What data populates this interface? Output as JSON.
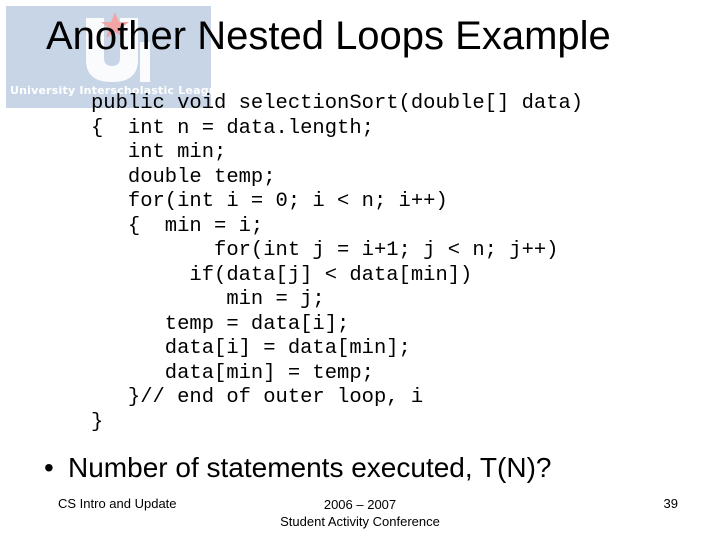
{
  "logo": {
    "text": "University Interscholastic League",
    "colors": {
      "background": "#c7d5e6",
      "letters": "#ffffff",
      "star": "#f2a5a5"
    }
  },
  "title": "Another Nested Loops Example",
  "code_lines": [
    "public void selectionSort(double[] data)",
    "{  int n = data.length;",
    "   int min;",
    "   double temp;",
    "   for(int i = 0; i < n; i++)",
    "   {  min = i;",
    "          for(int j = i+1; j < n; j++)",
    "        if(data[j] < data[min])",
    "           min = j;",
    "      temp = data[i];",
    "      data[i] = data[min];",
    "      data[min] = temp;",
    "   }// end of outer loop, i",
    "}"
  ],
  "bullet": {
    "symbol": "•",
    "text": "Number of statements executed, T(N)?"
  },
  "footer": {
    "left": "CS Intro and Update",
    "center_line1": "2006 – 2007",
    "center_line2": "Student Activity Conference",
    "page_number": "39"
  }
}
